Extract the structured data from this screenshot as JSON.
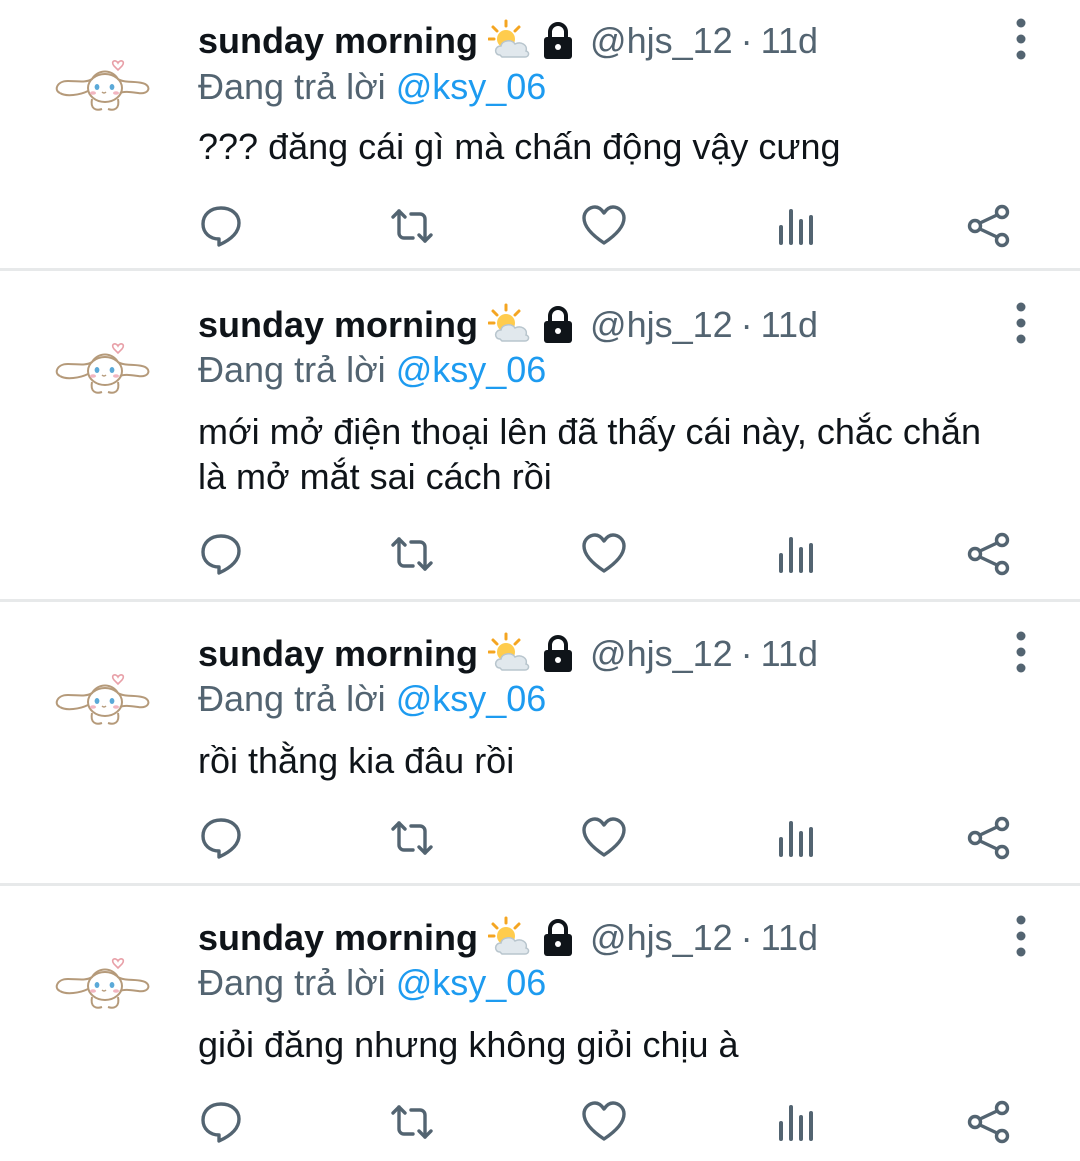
{
  "colors": {
    "name": "#0f1419",
    "meta": "#536471",
    "mention": "#1d9bf0",
    "icon": "#536471",
    "divider": "#e7e9ea"
  },
  "tweets": [
    {
      "display_name": "sunday morning",
      "name_emoji": "sun-behind-cloud-emoji",
      "protected_icon": "lock-icon",
      "handle": "@hjs_12",
      "separator": "·",
      "time": "11d",
      "replying_prefix": "Đang trả lời",
      "replying_to": "@ksy_06",
      "text": "??? đăng cái gì mà chấn động vậy cưng"
    },
    {
      "display_name": "sunday morning",
      "name_emoji": "sun-behind-cloud-emoji",
      "protected_icon": "lock-icon",
      "handle": "@hjs_12",
      "separator": "·",
      "time": "11d",
      "replying_prefix": "Đang trả lời",
      "replying_to": "@ksy_06",
      "text": "mới mở điện thoại lên đã thấy cái này, chắc chắn là mở mắt sai cách rồi"
    },
    {
      "display_name": "sunday morning",
      "name_emoji": "sun-behind-cloud-emoji",
      "protected_icon": "lock-icon",
      "handle": "@hjs_12",
      "separator": "·",
      "time": "11d",
      "replying_prefix": "Đang trả lời",
      "replying_to": "@ksy_06",
      "text": "rồi thằng kia đâu rồi"
    },
    {
      "display_name": "sunday morning",
      "name_emoji": "sun-behind-cloud-emoji",
      "protected_icon": "lock-icon",
      "handle": "@hjs_12",
      "separator": "·",
      "time": "11d",
      "replying_prefix": "Đang trả lời",
      "replying_to": "@ksy_06",
      "text": "giỏi đăng nhưng không giỏi chịu à"
    }
  ],
  "action_icons": [
    "reply-icon",
    "retweet-icon",
    "like-icon",
    "views-icon",
    "share-icon"
  ]
}
